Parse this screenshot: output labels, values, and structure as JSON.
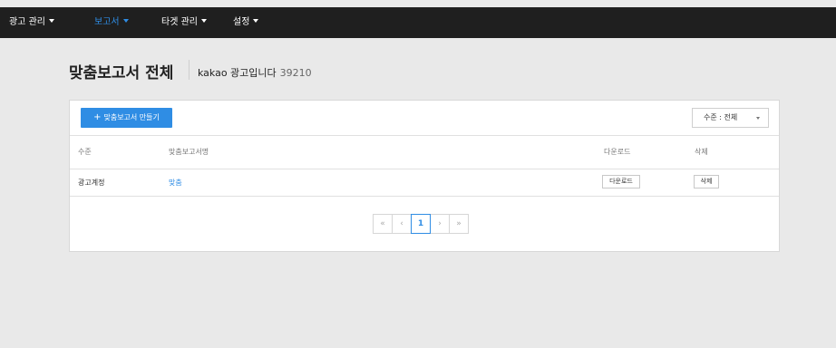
{
  "nav": {
    "items": [
      {
        "label": "광고 관리",
        "active": false
      },
      {
        "label": "보고서",
        "active": true
      },
      {
        "label": "타겟 관리",
        "active": false
      },
      {
        "label": "설정",
        "active": false
      }
    ]
  },
  "page": {
    "title": "맞춤보고서 전체",
    "account_name": "kakao 광고입니다",
    "account_id": "39210"
  },
  "toolbar": {
    "create_button_label": "맞춤보고서 만들기",
    "filter_selected": "수준 : 전체"
  },
  "table": {
    "columns": [
      "수준",
      "맞춤보고서명",
      "다운로드",
      "삭제"
    ],
    "rows": [
      {
        "level": "광고계정",
        "name": "맞춤",
        "download_label": "다운로드",
        "delete_label": "삭제"
      }
    ]
  },
  "pagination": {
    "first": "«",
    "prev": "‹",
    "current": "1",
    "next": "›",
    "last": "»"
  },
  "colors": {
    "accent": "#2f8de4",
    "topbar": "#1f1f1f",
    "background": "#e9e9e9"
  }
}
